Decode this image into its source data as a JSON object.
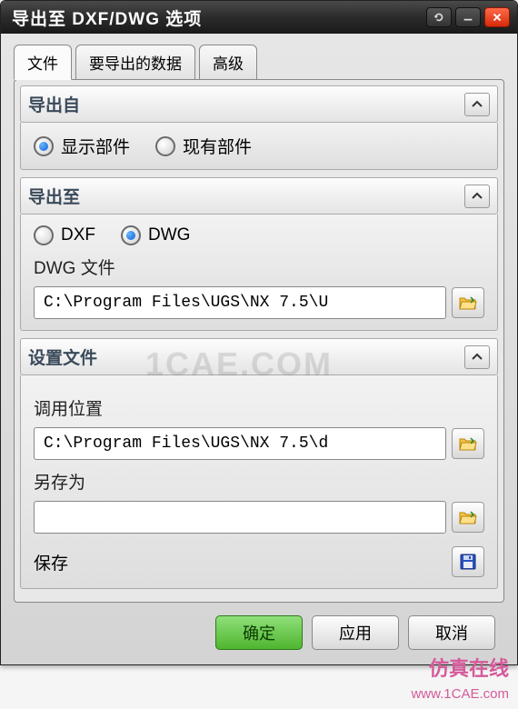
{
  "window": {
    "title": "导出至 DXF/DWG 选项"
  },
  "tabs": {
    "file": "文件",
    "data": "要导出的数据",
    "advanced": "高级"
  },
  "groups": {
    "from": {
      "title": "导出自",
      "opt_displayed": "显示部件",
      "opt_existing": "现有部件"
    },
    "to": {
      "title": "导出至",
      "opt_dxf": "DXF",
      "opt_dwg": "DWG",
      "file_label": "DWG 文件",
      "file_value": "C:\\Program Files\\UGS\\NX 7.5\\U"
    },
    "settings": {
      "title": "设置文件",
      "call_label": "调用位置",
      "call_value": "C:\\Program Files\\UGS\\NX 7.5\\d",
      "saveas_label": "另存为",
      "saveas_value": "",
      "save_label": "保存"
    }
  },
  "footer": {
    "ok": "确定",
    "apply": "应用",
    "cancel": "取消"
  },
  "watermark": {
    "big": "1CAE.COM",
    "small1": "仿真在线",
    "small2": "www.1CAE.com"
  }
}
